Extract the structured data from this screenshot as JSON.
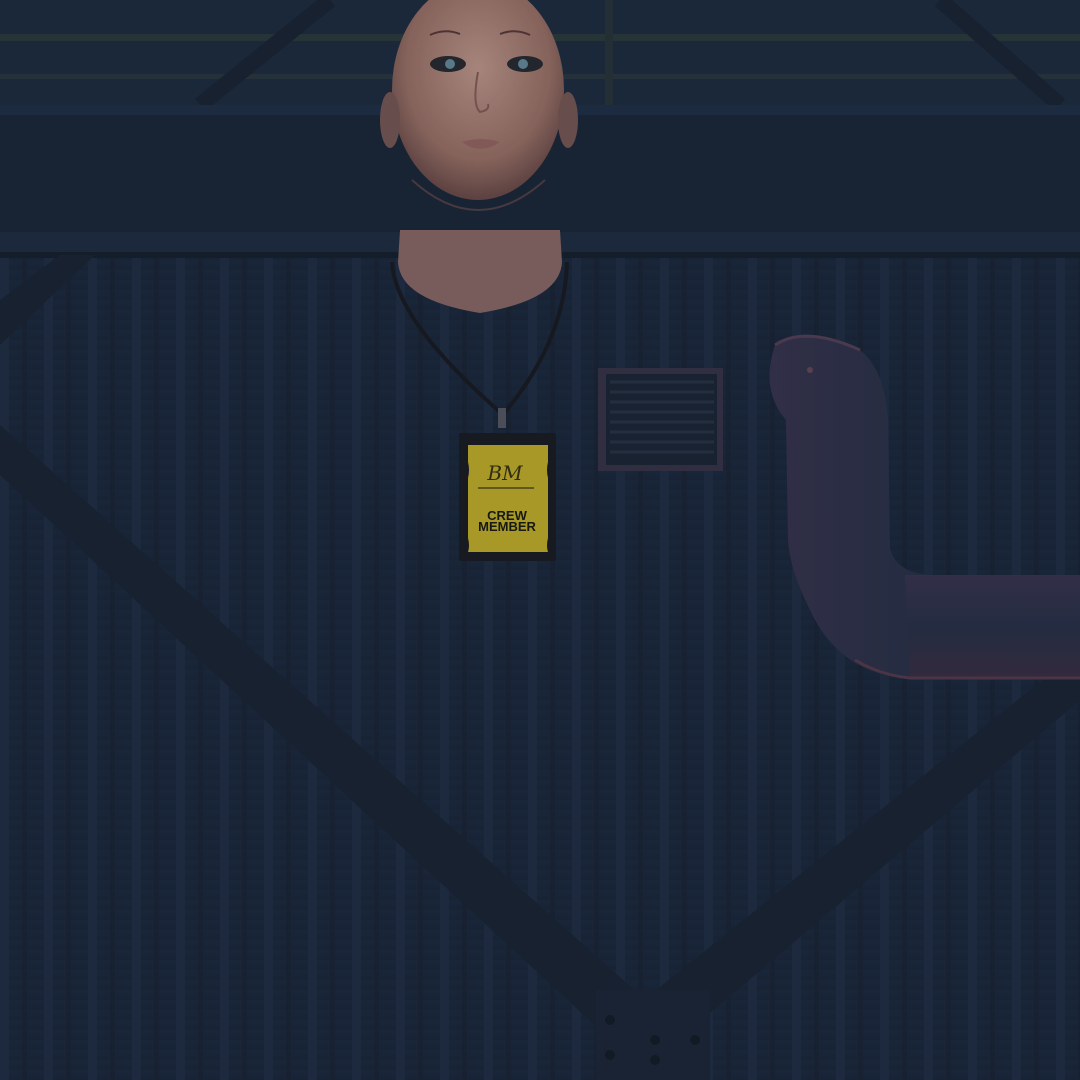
{
  "scene": {
    "setting": "warehouse-interior-wall",
    "colors": {
      "wall": "#1e2a3e",
      "wall_dark": "#17212f",
      "wall_stripe": "#24324a",
      "beam": "#1a2536",
      "badge_gold": "#cbb52a",
      "badge_border": "#1c1c22",
      "skin": "#b88c80",
      "duct": "#2b3248"
    }
  },
  "badge": {
    "monogram": "BM",
    "line1": "CREW",
    "line2": "MEMBER"
  }
}
